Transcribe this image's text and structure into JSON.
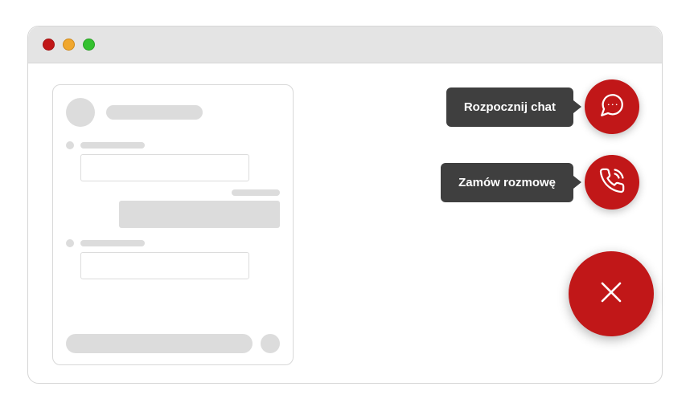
{
  "actions": {
    "chat": {
      "label": "Rozpocznij chat"
    },
    "call": {
      "label": "Zamów rozmowę"
    }
  },
  "colors": {
    "accent": "#c11718",
    "tooltip_bg": "#3f3f3f"
  }
}
